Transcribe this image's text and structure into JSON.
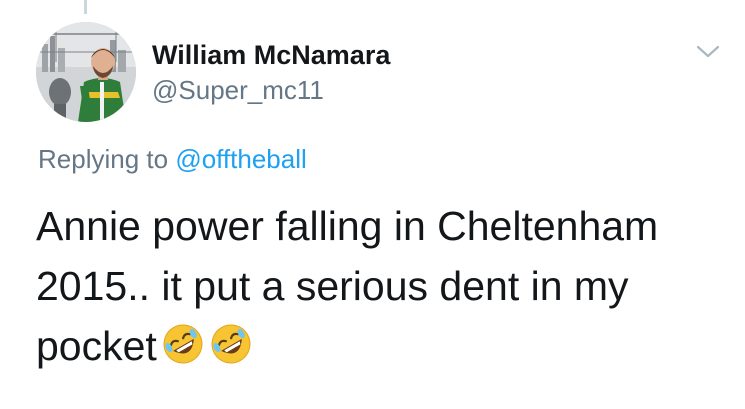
{
  "author": {
    "display_name": "William McNamara",
    "handle": "@Super_mc11"
  },
  "reply": {
    "prefix": "Replying to",
    "mention": "@offtheball"
  },
  "tweet": {
    "line1": "Annie power falling in Cheltenham",
    "line2": "2015.. it put a serious dent in my",
    "line3": "pocket",
    "emojis": [
      "rolling-on-floor-laughing",
      "rolling-on-floor-laughing"
    ]
  },
  "icons": {
    "menu": "chevron-down-icon"
  },
  "colors": {
    "mention": "#1da1f2",
    "secondary_text": "#657786",
    "primary_text": "#14171a"
  }
}
